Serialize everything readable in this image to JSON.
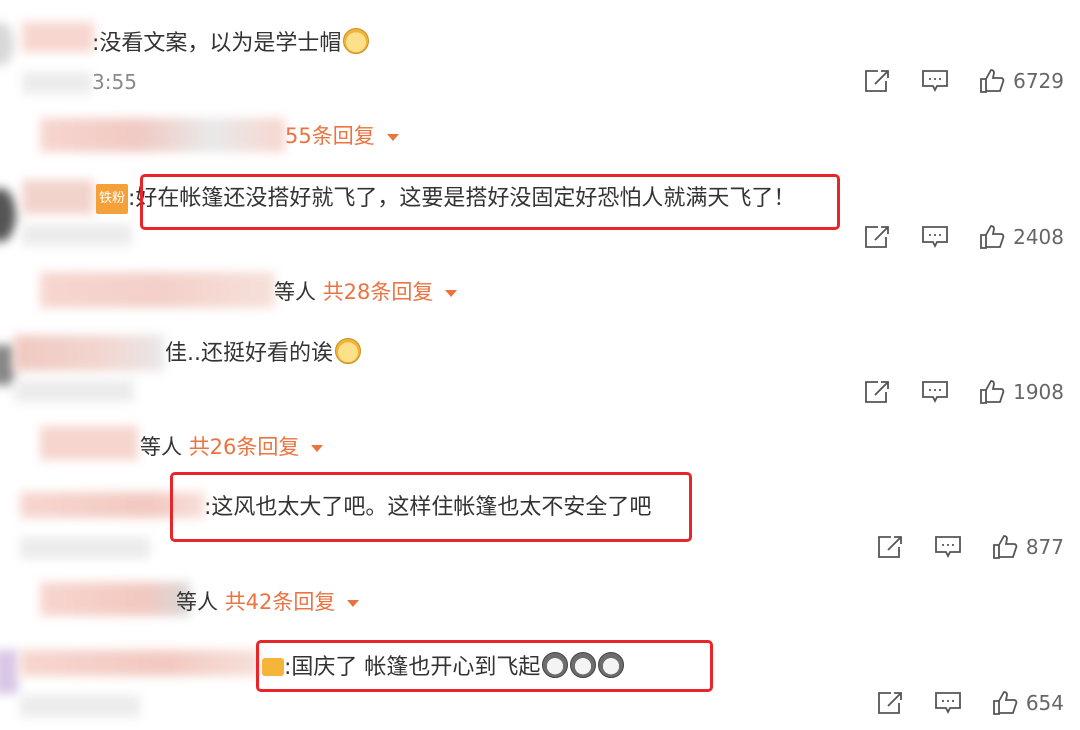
{
  "comments": [
    {
      "text": ":没看文案，以为是学士帽",
      "time": "3:55",
      "likes": "6729",
      "replies": {
        "prefix": "",
        "link": "55条回复"
      }
    },
    {
      "badge": "铁粉",
      "text": ":好在帐篷还没搭好就飞了，这要是搭好没固定好恐怕人就满天飞了！",
      "likes": "2408",
      "replies": {
        "prefix": "等人",
        "link": "共28条回复"
      }
    },
    {
      "text": "佳..还挺好看的诶",
      "likes": "1908",
      "replies": {
        "prefix": "等人",
        "link": "共26条回复"
      }
    },
    {
      "text": ":这风也太大了吧。这样住帐篷也太不安全了吧",
      "likes": "877",
      "replies": {
        "prefix": "等人",
        "link": "共42条回复"
      }
    },
    {
      "text": ":国庆了 帐篷也开心到飞起",
      "likes": "654"
    }
  ],
  "icons": [
    "share-icon",
    "comment-icon",
    "like-icon",
    "dropdown-triangle-icon",
    "dog-emoji-icon",
    "husky-emoji-icon"
  ],
  "colors": {
    "accent": "#eb7340",
    "highlight_box": "#e8262a",
    "text": "#333333",
    "meta": "#8a8a8a"
  }
}
